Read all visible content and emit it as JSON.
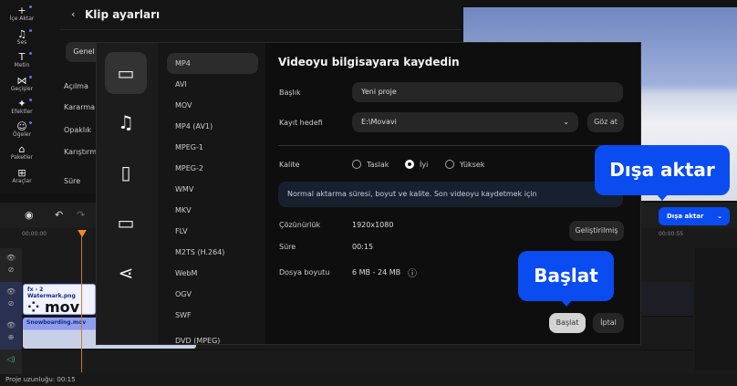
{
  "toolbar": [
    {
      "label": "İçe Aktar",
      "icon": "plus-icon",
      "glyph": "+"
    },
    {
      "label": "Ses",
      "icon": "music-icon",
      "glyph": "♫"
    },
    {
      "label": "Metin",
      "icon": "text-icon",
      "glyph": "T"
    },
    {
      "label": "Geçişler",
      "icon": "transition-icon",
      "glyph": "⋈"
    },
    {
      "label": "Efektler",
      "icon": "sparkle-icon",
      "glyph": "✦"
    },
    {
      "label": "Öğeler",
      "icon": "smiley-icon",
      "glyph": "☺"
    },
    {
      "label": "Paketler",
      "icon": "package-icon",
      "glyph": "⌂"
    },
    {
      "label": "Araçlar",
      "icon": "tools-icon",
      "glyph": "⊞"
    }
  ],
  "clip_settings": {
    "title": "Klip ayarları",
    "tab": "Genel",
    "labels": [
      "Açılma",
      "Kararma",
      "Opaklık",
      "Karıştırm",
      "Süre"
    ]
  },
  "timeline": {
    "time_start": "00:00:00",
    "time_end": "00:00:55",
    "clips": [
      {
        "name": "Watermark.png",
        "fx": "fx - 2",
        "text": "⁘ mov"
      },
      {
        "name": "Snowboarding.mov"
      }
    ]
  },
  "status": {
    "project_length": "Proje uzunluğu: 00:15"
  },
  "export_button": {
    "label": "Dışa aktar",
    "chevron": "⌄"
  },
  "dialog": {
    "categories": [
      {
        "icon": "video-icon",
        "glyph": "▭"
      },
      {
        "icon": "music-icon",
        "glyph": "♫"
      },
      {
        "icon": "phone-icon",
        "glyph": "▯"
      },
      {
        "icon": "monitor-icon",
        "glyph": "▭"
      },
      {
        "icon": "share-icon",
        "glyph": "⋖"
      }
    ],
    "formats": [
      "MP4",
      "AVI",
      "MOV",
      "MP4 (AV1)",
      "MPEG-1",
      "MPEG-2",
      "WMV",
      "MKV",
      "FLV",
      "M2TS (H.264)",
      "WebM",
      "OGV",
      "SWF",
      "DVD (MPEG)"
    ],
    "heading": "Videoyu bilgisayara kaydedin",
    "title_label": "Başlık",
    "title_value": "Yeni proje",
    "dest_label": "Kayıt hedefi",
    "dest_value": "E:\\Movavi",
    "browse": "Göz at",
    "quality_label": "Kalite",
    "quality_options": [
      "Taslak",
      "İyi",
      "Yüksek"
    ],
    "quality_selected": "İyi",
    "info": "Normal aktarma süresi, boyut ve kalite. Son videoyu kaydetmek için",
    "resolution_label": "Çözünürlük",
    "resolution": "1920x1080",
    "advanced": "Geliştirilmiş",
    "duration_label": "Süre",
    "duration": "00:15",
    "size_label": "Dosya boyutu",
    "size": "6 MB - 24 MB",
    "start": "Başlat",
    "cancel": "İptal"
  },
  "callouts": {
    "export": "Dışa aktar",
    "start": "Başlat"
  }
}
